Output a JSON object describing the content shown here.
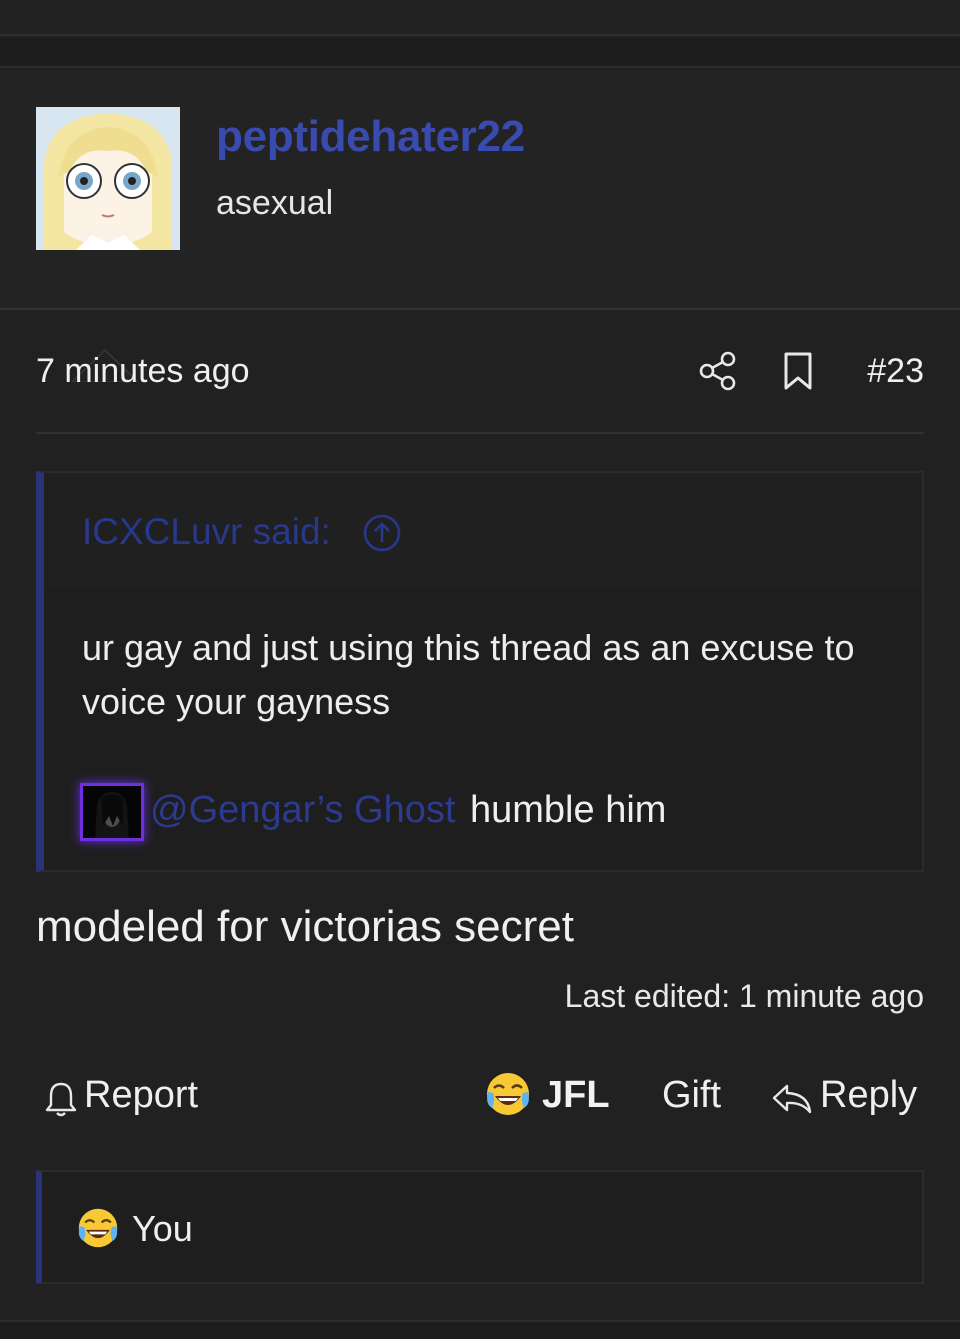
{
  "post": {
    "username": "peptidehater22",
    "user_title": "asexual",
    "timestamp": "7 minutes ago",
    "post_number": "#23",
    "body": "modeled for victorias secret",
    "last_edited": "Last edited: 1 minute ago"
  },
  "quote": {
    "author": "ICXCLuvr said:",
    "body": "ur gay and just using this thread as an excuse to voice your gayness",
    "mention": "@Gengar’s Ghost",
    "mention_text": "humble him"
  },
  "actions": {
    "report": "Report",
    "reaction": "JFL",
    "gift": "Gift",
    "reply": "Reply"
  },
  "reactions": {
    "reactor": "You"
  },
  "colors": {
    "background": "#212121",
    "username": "#3a4bb0",
    "quote_accent": "#2a3378",
    "link": "#2c3a8f",
    "mention_glow": "#6f2fe0"
  },
  "icons": [
    "share-icon",
    "bookmark-icon",
    "quote-jump-icon",
    "bell-icon",
    "laughing-crying-icon",
    "reply-arrow-icon"
  ]
}
